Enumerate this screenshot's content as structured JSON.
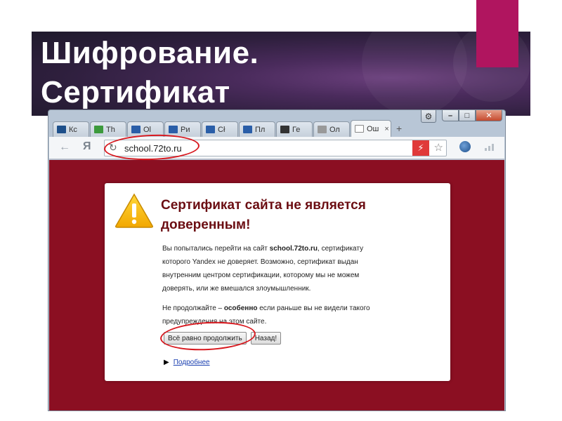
{
  "slide": {
    "title_line1": "Шифрование.",
    "title_line2": "Сертификат",
    "accent_color": "#b0155f"
  },
  "browser": {
    "tabs": [
      {
        "label": "Кс",
        "icon": "person-icon",
        "color": "#1d4f8a"
      },
      {
        "label": "Th",
        "icon": "chart-icon",
        "color": "#3c9a3c"
      },
      {
        "label": "Ol",
        "icon": "site-icon",
        "color": "#2a5ea8"
      },
      {
        "label": "Ри",
        "icon": "site-icon",
        "color": "#2a5ea8"
      },
      {
        "label": "Сł",
        "icon": "site-icon",
        "color": "#2a5ea8"
      },
      {
        "label": "Пл",
        "icon": "site-icon",
        "color": "#2a5ea8"
      },
      {
        "label": "Ге",
        "icon": "gear-round-icon",
        "color": "#333333"
      },
      {
        "label": "Ол",
        "icon": "image-icon",
        "color": "#999999"
      },
      {
        "label": "Ош",
        "icon": "page-icon",
        "color": "#ffffff",
        "active": true
      }
    ],
    "toolbar": {
      "back_glyph": "←",
      "yandex_glyph": "Я",
      "url": "school.72to.ru",
      "close_glyph": "×",
      "new_tab_glyph": "+"
    },
    "window_controls": {
      "minimize": "–",
      "maximize": "□",
      "close": "✕"
    }
  },
  "warning": {
    "heading_line1": "Сертификат сайта не является",
    "heading_line2": "доверенным!",
    "p1_before": "Вы попытались перейти на сайт ",
    "p1_site": "school.72to.ru",
    "p1_after_line1": ", сертификату",
    "p1_line2": "которого Yandex не доверяет. Возможно, сертификат выдан",
    "p1_line3": "внутренним центром сертификации, которому мы не можем",
    "p1_line4": "доверять, или же вмешался злоумышленник.",
    "p2_before": "Не продолжайте – ",
    "p2_bold": "особенно",
    "p2_after_line1": " если раньше вы не видели такого",
    "p2_line2": "предупреждения на этом сайте.",
    "proceed_button": "Всё равно продолжить",
    "back_button": "Назад!",
    "more_link": "Подробнее",
    "page_bg_color": "#8b0f22",
    "heading_color": "#6b0d12",
    "annotation_color": "#d8191f"
  }
}
